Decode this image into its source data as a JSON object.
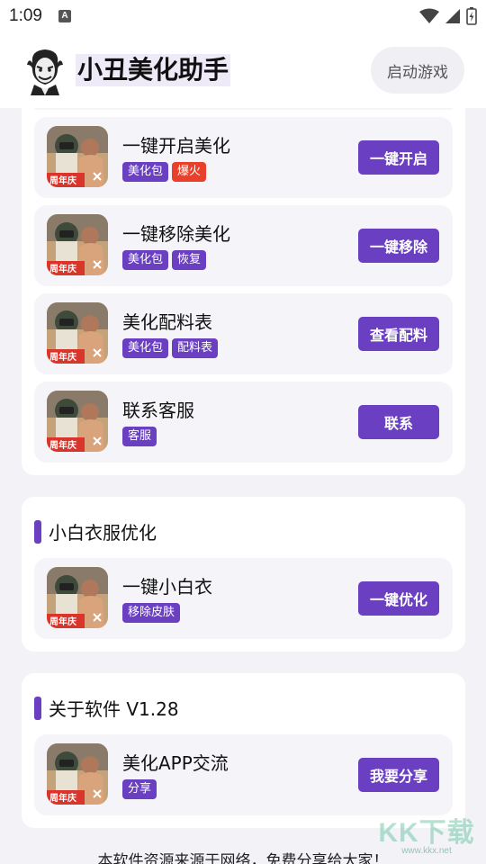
{
  "status_bar": {
    "time": "1:09",
    "a_icon": "A"
  },
  "header": {
    "title": "小丑美化助手",
    "start_button": "启动游戏"
  },
  "sections": {
    "main": {
      "items": [
        {
          "title": "一键开启美化",
          "tags": [
            {
              "text": "美化包",
              "color": "#6a3fc2"
            },
            {
              "text": "爆火",
              "color": "#e8402b"
            }
          ],
          "button": "一键开启"
        },
        {
          "title": "一键移除美化",
          "tags": [
            {
              "text": "美化包",
              "color": "#6a3fc2"
            },
            {
              "text": "恢复",
              "color": "#6a3fc2"
            }
          ],
          "button": "一键移除"
        },
        {
          "title": "美化配料表",
          "tags": [
            {
              "text": "美化包",
              "color": "#6a3fc2"
            },
            {
              "text": "配料表",
              "color": "#6a3fc2"
            }
          ],
          "button": "查看配料"
        },
        {
          "title": "联系客服",
          "tags": [
            {
              "text": "客服",
              "color": "#6a3fc2"
            }
          ],
          "button": "联系"
        }
      ]
    },
    "white_clothes": {
      "title": "小白衣服优化",
      "items": [
        {
          "title": "一键小白衣",
          "tags": [
            {
              "text": "移除皮肤",
              "color": "#6a3fc2"
            }
          ],
          "button": "一键优化"
        }
      ]
    },
    "about": {
      "title": "关于软件 V1.28",
      "items": [
        {
          "title": "美化APP交流",
          "tags": [
            {
              "text": "分享",
              "color": "#6a3fc2"
            }
          ],
          "button": "我要分享"
        }
      ]
    }
  },
  "footer": {
    "text": "本软件资源来源于网络，免费分享给大家！"
  },
  "thumbnail": {
    "badge_text": "周年庆",
    "icon": "game-thumbnail"
  },
  "watermark": {
    "text": "KK下载",
    "url": "www.kkx.net"
  },
  "colors": {
    "accent": "#6a3fc2",
    "hot": "#e8402b"
  }
}
